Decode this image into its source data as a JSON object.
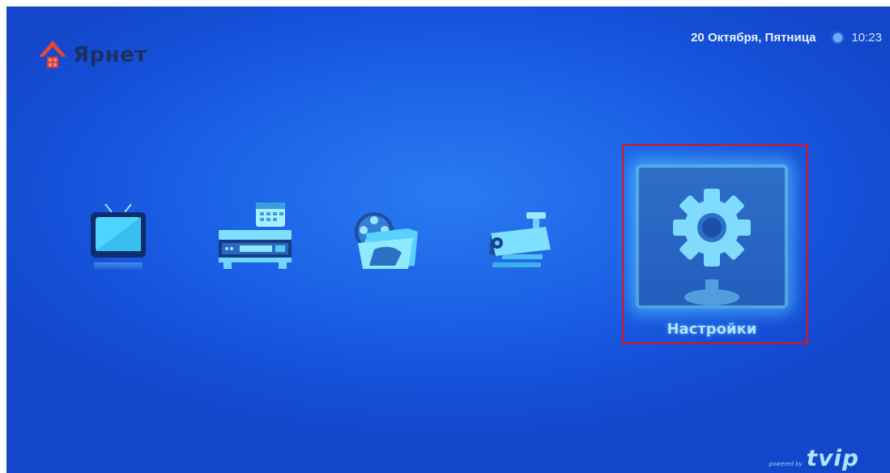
{
  "header": {
    "logo_text": "Ярнет",
    "date": "20 Октября, Пятница",
    "time": "10:23"
  },
  "menu": {
    "items": [
      {
        "id": "tv",
        "icon": "tv-icon"
      },
      {
        "id": "recorder",
        "icon": "recorder-calendar-icon"
      },
      {
        "id": "media",
        "icon": "media-folder-icon"
      },
      {
        "id": "camera",
        "icon": "security-camera-icon"
      },
      {
        "id": "settings",
        "icon": "gear-icon",
        "label": "Настройки",
        "selected": true
      }
    ]
  },
  "footer": {
    "powered_by": "powered by",
    "brand": "tvip"
  },
  "colors": {
    "background": "#1c62e6",
    "highlight": "#e01020",
    "accent": "#6fd0ff"
  }
}
